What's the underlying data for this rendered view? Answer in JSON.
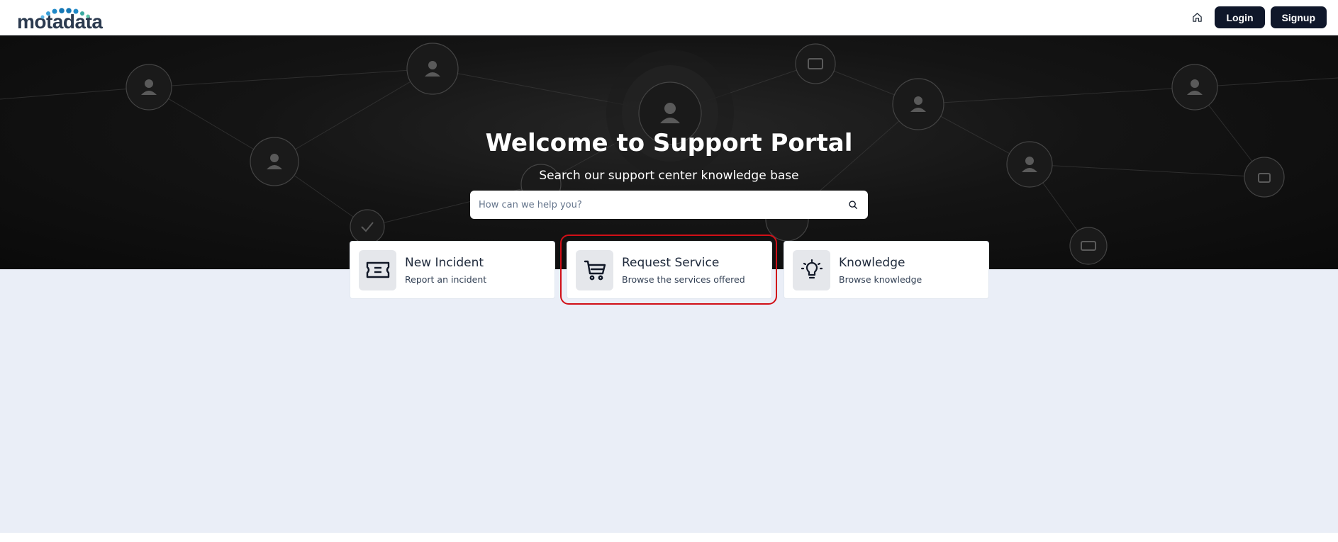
{
  "header": {
    "logo_text": "motadata",
    "home_icon": "home-icon",
    "login_label": "Login",
    "signup_label": "Signup"
  },
  "hero": {
    "title": "Welcome to Support Portal",
    "subtitle": "Search our support center knowledge base",
    "search_placeholder": "How can we help you?",
    "search_icon": "search-icon"
  },
  "cards": [
    {
      "title": "New Incident",
      "description": "Report an incident",
      "icon": "ticket-icon"
    },
    {
      "title": "Request Service",
      "description": "Browse the services offered",
      "icon": "cart-icon"
    },
    {
      "title": "Knowledge",
      "description": "Browse knowledge",
      "icon": "lightbulb-icon"
    }
  ],
  "colors": {
    "button_bg": "#0f172a",
    "hero_bg": "#141414",
    "page_bg": "#eaeef7",
    "highlight": "#d10f17",
    "logo_dots": "#1e88c7"
  }
}
